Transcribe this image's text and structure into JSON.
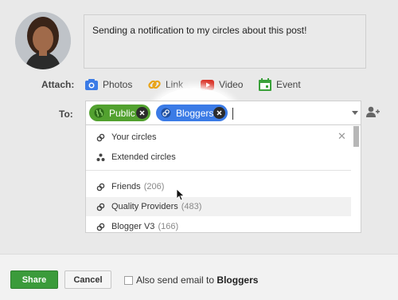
{
  "post": {
    "text": "Sending a notification to my circles about this post!"
  },
  "attach": {
    "label": "Attach:",
    "items": [
      {
        "label": "Photos",
        "icon": "camera-icon",
        "color": "#3b7be6"
      },
      {
        "label": "Link",
        "icon": "link-icon",
        "color": "#e8a317"
      },
      {
        "label": "Video",
        "icon": "video-icon",
        "color": "#d93025"
      },
      {
        "label": "Event",
        "icon": "calendar-icon",
        "color": "#3aa13a"
      }
    ]
  },
  "to": {
    "label": "To:",
    "chips": [
      {
        "label": "Public",
        "icon": "globe-icon",
        "color": "#52a12f"
      },
      {
        "label": "Bloggers",
        "icon": "circles-link-icon",
        "color": "#3b7be6"
      }
    ]
  },
  "dropdown": {
    "close_symbol": "✕",
    "items": [
      {
        "label": "Your circles",
        "count": "",
        "icon": "circles-link-icon"
      },
      {
        "label": "Extended circles",
        "count": "",
        "icon": "extended-circles-icon"
      },
      {
        "label": "Friends",
        "count": "(206)",
        "icon": "circles-link-icon"
      },
      {
        "label": "Quality Providers",
        "count": "(483)",
        "icon": "circles-link-icon"
      },
      {
        "label": "Blogger V3",
        "count": "(166)",
        "icon": "circles-link-icon"
      }
    ]
  },
  "footer": {
    "share_label": "Share",
    "cancel_label": "Cancel",
    "email_prefix": "Also send email to",
    "email_target": "Bloggers"
  },
  "colors": {
    "share": "#3b9b3b",
    "public_chip": "#52a12f",
    "bloggers_chip": "#3b7be6"
  }
}
